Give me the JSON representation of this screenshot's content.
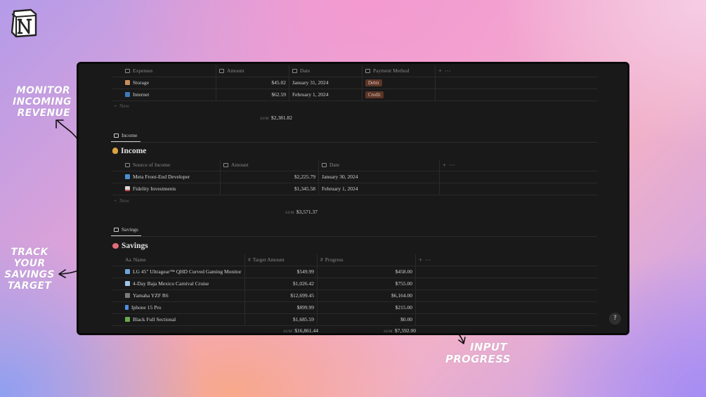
{
  "callouts": {
    "monitor": [
      "MONITOR",
      "INCOMING",
      "REVENUE"
    ],
    "track": [
      "TRACK",
      "YOUR",
      "SAVINGS",
      "TARGET"
    ],
    "input": [
      "INPUT",
      "PROGRESS"
    ]
  },
  "expenses": {
    "columns": [
      "Expenses",
      "Amount",
      "Date",
      "Payment Method"
    ],
    "rows": [
      {
        "name": "Storage",
        "amount": "$45.02",
        "date": "January 31, 2024",
        "method": "Debit"
      },
      {
        "name": "Internet",
        "amount": "$62.59",
        "date": "February 1, 2024",
        "method": "Credit"
      }
    ],
    "new_label": "New",
    "sum_label": "SUM",
    "sum_value": "$2,381.82"
  },
  "income": {
    "tab_label": "Income",
    "title": "Income",
    "columns": [
      "Source of Income",
      "Amount",
      "Date"
    ],
    "rows": [
      {
        "name": "Meta Front-End Developer",
        "amount": "$2,225.79",
        "date": "January 30, 2024"
      },
      {
        "name": "Fidelity Investments",
        "amount": "$1,345.58",
        "date": "February 1, 2024"
      }
    ],
    "new_label": "New",
    "sum_label": "SUM",
    "sum_value": "$3,571.37"
  },
  "savings": {
    "tab_label": "Savings",
    "title": "Savings",
    "columns": [
      "Name",
      "Target Amount",
      "Progress"
    ],
    "rows": [
      {
        "name": "LG 45\" Ultragear™ QHD Curved Gaming Monitor",
        "target": "$549.99",
        "progress": "$458.00"
      },
      {
        "name": "4-Day Baja Mexico Carnival Cruise",
        "target": "$1,026.42",
        "progress": "$755.00"
      },
      {
        "name": "Yamaha YZF R6",
        "target": "$12,699.45",
        "progress": "$6,164.00"
      },
      {
        "name": "Iphone 15 Pro",
        "target": "$899.99",
        "progress": "$215.00"
      },
      {
        "name": "Black Full Sectional",
        "target": "$1,685.59",
        "progress": "$0.00"
      }
    ],
    "sum_label": "SUM",
    "sum_target": "$16,861.44",
    "sum_progress": "$7,592.00"
  },
  "help_label": "?",
  "colors": {
    "window_bg": "#191919",
    "tag_bg": "#5c3527",
    "tag_text": "#e6c6b8"
  }
}
